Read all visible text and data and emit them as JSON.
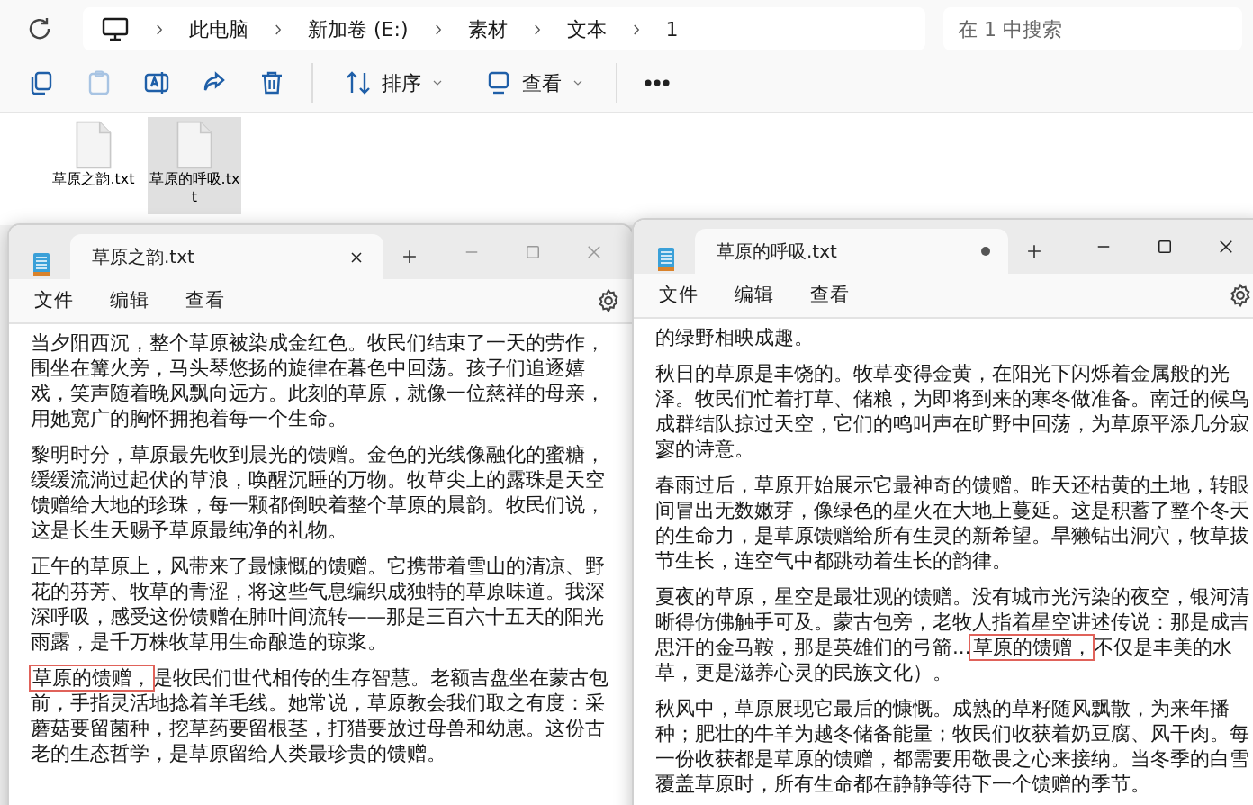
{
  "explorer": {
    "breadcrumb": [
      "此电脑",
      "新加卷 (E:)",
      "素材",
      "文本",
      "1"
    ],
    "search": {
      "placeholder": "在 1 中搜索"
    },
    "toolbar": [
      {
        "kind": "copy",
        "disabled": false
      },
      {
        "kind": "paste",
        "disabled": true
      },
      {
        "kind": "rename",
        "disabled": false
      },
      {
        "kind": "share",
        "disabled": false
      },
      {
        "kind": "delete",
        "disabled": false
      },
      {
        "kind": "sort",
        "label": "排序",
        "disabled": false
      },
      {
        "kind": "view",
        "label": "查看",
        "disabled": false
      },
      {
        "kind": "more",
        "disabled": false
      }
    ],
    "files": [
      {
        "name": "草原之韵.txt",
        "selected": false
      },
      {
        "name": "草原的呼吸.txt",
        "selected": true
      }
    ]
  },
  "windows": [
    {
      "tab": "草原之韵.txt",
      "unsaved": false,
      "active": false,
      "menu": [
        "文件",
        "编辑",
        "查看"
      ],
      "paragraphs": [
        [
          {
            "text": "当夕阳西沉，整个草原被染成金红色。牧民们结束了一天的劳作，围坐在篝火旁，马头琴悠扬的旋律在暮色中回荡。孩子们追逐嬉戏，笑声随着晚风飘向远方。此刻的草原，就像一位慈祥的母亲，用她宽广的胸怀拥抱着每一个生命。",
            "highlighted": false
          }
        ],
        [
          {
            "text": "黎明时分，草原最先收到晨光的馈赠。金色的光线像融化的蜜糖，缓缓流淌过起伏的草浪，唤醒沉睡的万物。牧草尖上的露珠是天空馈赠给大地的珍珠，每一颗都倒映着整个草原的晨韵。牧民们说，这是长生天赐予草原最纯净的礼物。",
            "highlighted": false
          }
        ],
        [
          {
            "text": "正午的草原上，风带来了最慷慨的馈赠。它携带着雪山的清凉、野花的芬芳、牧草的青涩，将这些气息编织成独特的草原味道。我深深呼吸，感受这份馈赠在肺叶间流转——那是三百六十五天的阳光雨露，是千万株牧草用生命酿造的琼浆。",
            "highlighted": false
          }
        ],
        [
          {
            "text": "草原的馈赠，",
            "highlighted": true
          },
          {
            "text": "是牧民们世代相传的生存智慧。老额吉盘坐在蒙古包前，手指灵活地捻着羊毛线。她常说，草原教会我们取之有度：采蘑菇要留菌种，挖草药要留根茎，打猎要放过母兽和幼崽。这份古老的生态哲学，是草原留给人类最珍贵的馈赠。",
            "highlighted": false
          }
        ]
      ]
    },
    {
      "tab": "草原的呼吸.txt",
      "unsaved": true,
      "active": true,
      "menu": [
        "文件",
        "编辑",
        "查看"
      ],
      "paragraphs": [
        [
          {
            "text": "的绿野相映成趣。",
            "highlighted": false
          }
        ],
        [
          {
            "text": "秋日的草原是丰饶的。牧草变得金黄，在阳光下闪烁着金属般的光泽。牧民们忙着打草、储粮，为即将到来的寒冬做准备。南迁的候鸟成群结队掠过天空，它们的鸣叫声在旷野中回荡，为草原平添几分寂寥的诗意。",
            "highlighted": false
          }
        ],
        [
          {
            "text": "春雨过后，草原开始展示它最神奇的馈赠。昨天还枯黄的土地，转眼间冒出无数嫩芽，像绿色的星火在大地上蔓延。这是积蓄了整个冬天的生命力，是草原馈赠给所有生灵的新希望。旱獭钻出洞穴，牧草拔节生长，连空气中都跳动着生长的韵律。",
            "highlighted": false
          }
        ],
        [
          {
            "text": "夏夜的草原，星空是最壮观的馈赠。没有城市光污染的夜空，银河清晰得仿佛触手可及。蒙古包旁，老牧人指着星空讲述传说：那是成吉思汗的金马鞍，那是英雄们的弓箭...",
            "highlighted": false
          },
          {
            "text": "草原的馈赠，",
            "highlighted": true
          },
          {
            "text": "不仅是丰美的水草，更是滋养心灵的民族文化）。",
            "highlighted": false
          }
        ],
        [
          {
            "text": "秋风中，草原展现它最后的慷慨。成熟的草籽随风飘散，为来年播种；肥壮的牛羊为越冬储备能量；牧民们收获着奶豆腐、风干肉。每一份收获都是草原的馈赠，都需要用敬畏之心来接纳。当冬季的白雪覆盖草原时，所有生命都在静静等待下一个馈赠的季节。",
            "highlighted": false
          }
        ]
      ]
    }
  ]
}
